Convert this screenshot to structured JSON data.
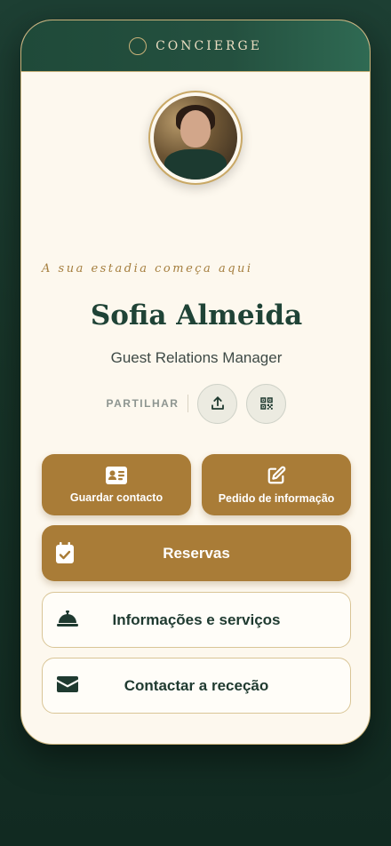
{
  "header": {
    "brand": "CONCIERGE"
  },
  "profile": {
    "tagline": "A sua estadia começa aqui",
    "name": "Sofia Almeida",
    "role": "Guest Relations Manager"
  },
  "share": {
    "label": "PARTILHAR"
  },
  "actions": {
    "save_contact": "Guardar contacto",
    "info_request": "Pedido de informação",
    "reservations": "Reservas",
    "info_services": "Informações e serviços",
    "contact_reception": "Contactar a receção"
  },
  "colors": {
    "accent_gold": "#a97c37",
    "primary_green": "#1f4336",
    "background": "#fdf8ee"
  }
}
